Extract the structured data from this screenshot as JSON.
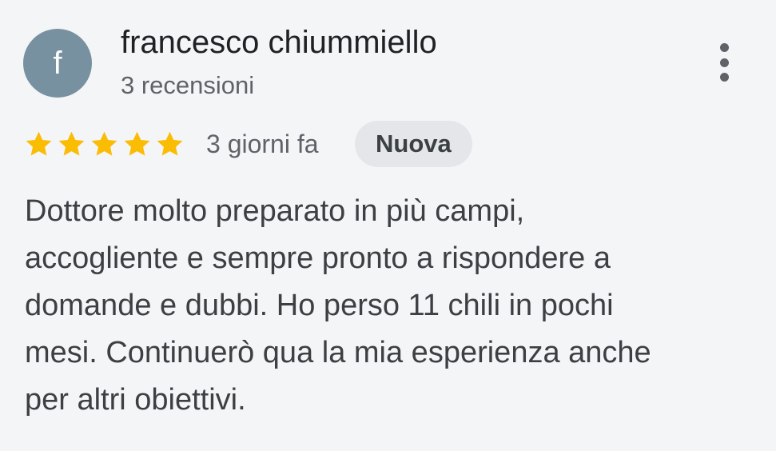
{
  "review": {
    "author": {
      "initial": "f",
      "name": "francesco chiummiello",
      "review_count": "3 recensioni",
      "avatar_color": "#7891a0"
    },
    "more_menu_icon": "more-vert-icon",
    "rating": 5,
    "rating_max": 5,
    "star_icon": "star-icon",
    "star_color": "#fbbc04",
    "time": "3 giorni fa",
    "badge": "Nuova",
    "text": "Dottore molto preparato in più campi,\naccogliente e sempre pronto a rispondere a\ndomande e dubbi. Ho perso 11 chili in pochi\nmesi. Continuerò qua la mia esperienza anche\nper altri obiettivi."
  }
}
